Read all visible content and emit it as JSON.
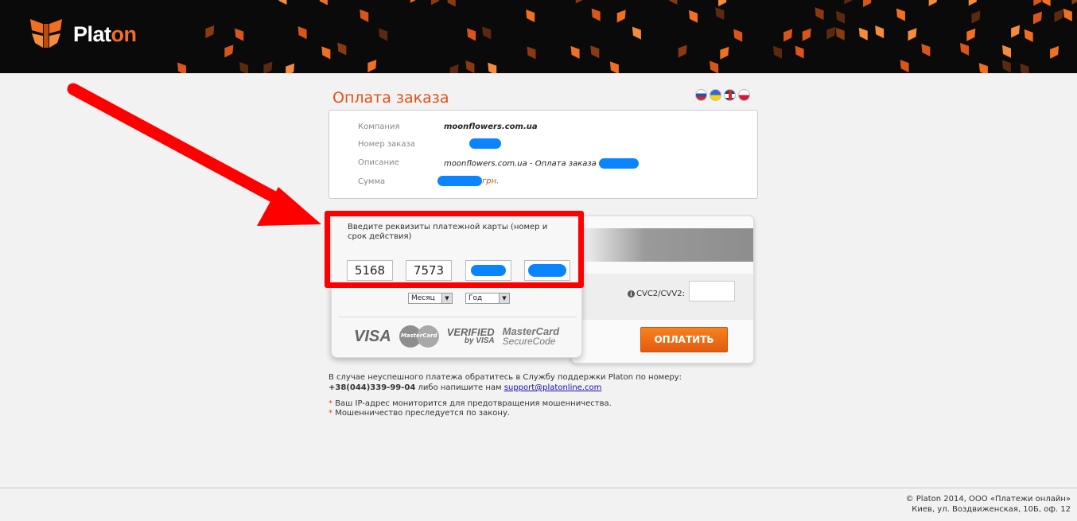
{
  "header": {
    "logo_text_main": "Plat",
    "logo_text_accent": "on",
    "logo_color": "#f26f21"
  },
  "page": {
    "title": "Оплата заказа",
    "languages": [
      "ru",
      "ua",
      "en",
      "pl"
    ]
  },
  "order": {
    "company_label": "Компания",
    "company_value": "moonflowers.com.ua",
    "number_label": "Номер заказа",
    "description_label": "Описание",
    "description_value": "moonflowers.com.ua - Оплата заказа",
    "amount_label": "Сумма",
    "amount_currency": "грн."
  },
  "card_form": {
    "instruction": "Введите реквизиты платежной карты (номер и срок действия)",
    "number_part1": "5168",
    "number_part2": "7573",
    "month_select": "Месяц",
    "year_select": "Год",
    "cvc_label": "CVC2/CVV2:",
    "pay_button": "ОПЛАТИТЬ",
    "brands": {
      "visa": "VISA",
      "mastercard": "MasterCard",
      "verified_1": "VERIFIED",
      "verified_2": "by VISA",
      "securecode_1": "MasterCard",
      "securecode_2": "SecureCode"
    }
  },
  "support": {
    "line1": "В случае неуспешного платежа обратитесь в Службу поддержки Platon по номеру:",
    "phone": "+38(044)339-99-04",
    "middle": "либо напишите нам",
    "email": "support@platonline.com"
  },
  "notes": [
    "Ваш IP-адрес мониторится для предотвращения мошенничества.",
    "Мошенничество преследуется по закону."
  ],
  "footer": {
    "line1": "© Platon 2014, ООО «Платежи онлайн»",
    "line2": "Киев, ул. Воздвиженская, 10Б, оф. 12"
  },
  "colors": {
    "accent": "#e0521b",
    "pay_button": "#f26f21",
    "highlight": "#ff0000"
  }
}
